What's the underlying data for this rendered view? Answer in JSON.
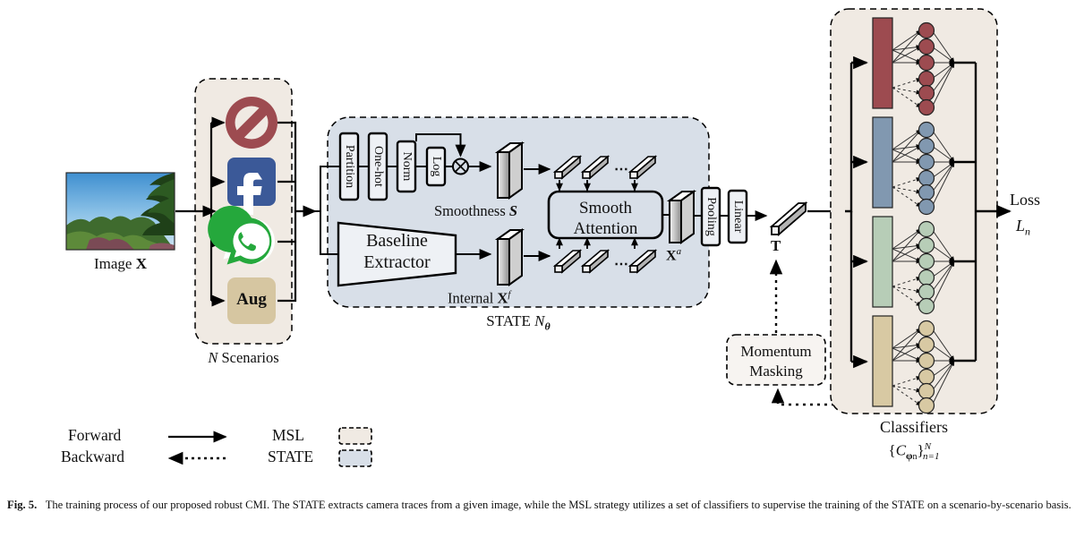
{
  "figure": {
    "number": "Fig. 5.",
    "caption": "The training process of our proposed robust CMI. The STATE extracts camera traces from a given image, while the MSL strategy utilizes a set of classifiers to supervise the training of the STATE on a scenario-by-scenario basis."
  },
  "input": {
    "image_label": "Image ",
    "image_symbol": "X"
  },
  "scenarios": {
    "caption_prefix": "N",
    "caption_suffix": " Scenarios",
    "items": [
      {
        "name": "no-sharing-scenario",
        "icon": "prohibition-icon",
        "label": "",
        "color": "#9d4b50"
      },
      {
        "name": "facebook-scenario",
        "icon": "facebook-icon",
        "label": "",
        "color": "#3b5998"
      },
      {
        "name": "whatsapp-scenario",
        "icon": "whatsapp-icon",
        "label": "",
        "color": "#25a83c"
      },
      {
        "name": "augmentation-scenario",
        "icon": "aug-box-icon",
        "label": "Aug",
        "color": "#d6c6a1"
      }
    ]
  },
  "state": {
    "caption": "STATE ",
    "caption_symbol": "N",
    "caption_sub": "θ",
    "pipeline_blocks": [
      "Partition",
      "One-hot",
      "Norm",
      "Log"
    ],
    "multiply_op": "⊗",
    "smoothness_label": "Smoothness ",
    "smoothness_symbol": "S",
    "extractor_line1": "Baseline",
    "extractor_line2": "Extractor",
    "internal_label": "Internal ",
    "internal_symbol": "X",
    "internal_sup": "f",
    "attention_line1": "Smooth",
    "attention_line2": "Attention",
    "attended_symbol": "X",
    "attended_sup": "a",
    "post_blocks": [
      "Pooling",
      "Linear"
    ],
    "ellipsis": "⋯"
  },
  "trace": {
    "symbol": "T"
  },
  "momentum": {
    "line1": "Momentum",
    "line2": "Masking"
  },
  "classifiers": {
    "caption": "Classifiers",
    "notation_open": "{",
    "notation_c": "C",
    "notation_sub": "φ",
    "notation_sub2": "n",
    "notation_close": "}",
    "notation_sup": "N",
    "notation_bot": "n=1",
    "rows": [
      {
        "name": "classifier-1",
        "bar_color": "#9d4b50",
        "node_color": "#9d4b50",
        "nodes": 6
      },
      {
        "name": "classifier-2",
        "bar_color": "#8198b0",
        "node_color": "#8198b0",
        "nodes": 6
      },
      {
        "name": "classifier-3",
        "bar_color": "#b7cdb7",
        "node_color": "#b7cdb7",
        "nodes": 6
      },
      {
        "name": "classifier-4",
        "bar_color": "#d8c9a3",
        "node_color": "#d8c9a3",
        "nodes": 6
      }
    ]
  },
  "loss": {
    "label": "Loss",
    "symbol": "L",
    "sub": "n"
  },
  "legend": {
    "forward": "Forward",
    "backward": "Backward",
    "msl": "MSL",
    "state": "STATE",
    "msl_color": "#f0eae3",
    "state_color": "#d8dfe8"
  },
  "colors": {
    "msl_bg": "#f0eae3",
    "state_bg": "#d8dfe8",
    "stroke": "#000000"
  }
}
